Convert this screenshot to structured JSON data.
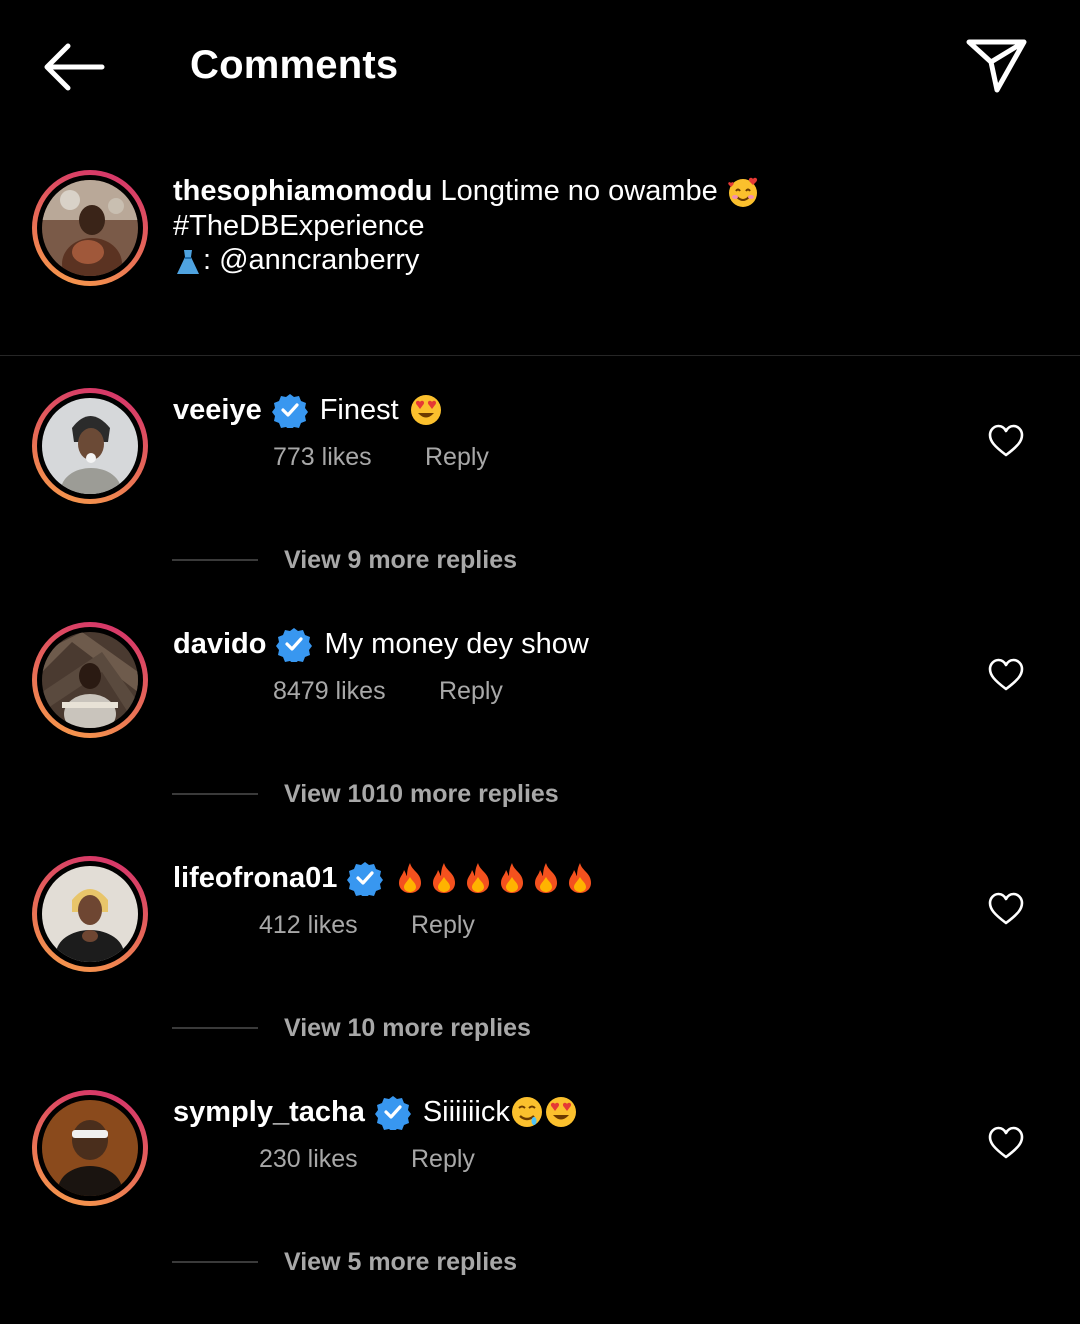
{
  "header": {
    "title": "Comments",
    "back_icon": "arrow-left-icon",
    "share_icon": "paper-plane-icon"
  },
  "caption": {
    "username": "thesophiamomodu",
    "text": "Longtime no owambe",
    "hashtag": "#TheDBExperience",
    "credit": ": @anncranberry"
  },
  "colors": {
    "background": "#000000",
    "secondary_text": "#a8a8a8",
    "verified_blue": "#3897f0",
    "divider": "#262626",
    "story_ring_start": "#f9a14a",
    "story_ring_end": "#d22b6d"
  },
  "comments": [
    {
      "username": "veeiye",
      "verified": true,
      "text": "Finest",
      "likes": "773 likes",
      "reply_label": "Reply",
      "view_replies": "View 9 more replies"
    },
    {
      "username": "davido",
      "verified": true,
      "text": "My money dey show",
      "likes": "8479 likes",
      "reply_label": "Reply",
      "view_replies": "View 1010 more replies"
    },
    {
      "username": "lifeofrona01",
      "verified": true,
      "text": "",
      "likes": "412 likes",
      "reply_label": "Reply",
      "view_replies": "View 10 more replies"
    },
    {
      "username": "symply_tacha",
      "verified": true,
      "text": "Siiiiiick",
      "likes": "230 likes",
      "reply_label": "Reply",
      "view_replies": "View 5 more replies"
    }
  ]
}
